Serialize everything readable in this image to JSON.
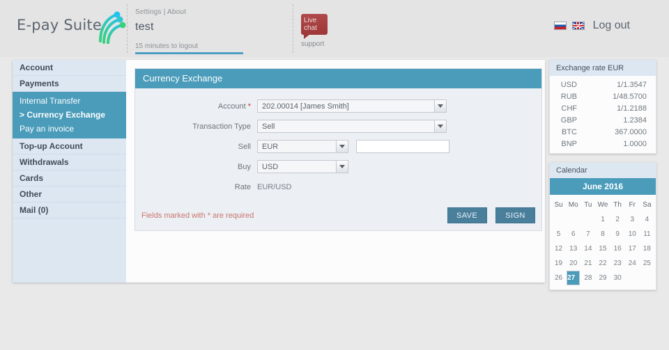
{
  "header": {
    "brand": "E-pay Suite",
    "logo_icon": "epay-swoosh-logo",
    "settings_label": "Settings",
    "settings_separator": "|",
    "about_label": "About",
    "account_name": "test",
    "logout_timer": "15 minutes to logout",
    "livechat_line1": "Live",
    "livechat_line2": "chat",
    "livechat_support": "support",
    "flag_ru": "flag-russia-icon",
    "flag_gb": "flag-uk-icon",
    "logout_label": "Log out"
  },
  "sidebar": {
    "items": [
      {
        "label": "Account"
      },
      {
        "label": "Payments"
      },
      {
        "label": "Top-up Account"
      },
      {
        "label": "Withdrawals"
      },
      {
        "label": "Cards"
      },
      {
        "label": "Other"
      },
      {
        "label": "Mail (0)"
      }
    ],
    "subitems": [
      {
        "label": "Internal Transfer"
      },
      {
        "label": "> Currency Exchange"
      },
      {
        "label": "Pay an invoice"
      }
    ]
  },
  "form": {
    "title": "Currency Exchange",
    "account_label": "Account",
    "account_required_mark": "*",
    "account_value": "202.00014 [James Smith]",
    "txtype_label": "Transaction Type",
    "txtype_value": "Sell",
    "sell_label": "Sell",
    "sell_currency": "EUR",
    "sell_amount": "",
    "sell_amount_placeholder": "",
    "buy_label": "Buy",
    "buy_currency": "USD",
    "rate_label": "Rate",
    "rate_value": "EUR/USD",
    "required_note": "Fields marked with * are required",
    "save_label": "SAVE",
    "sign_label": "SIGN"
  },
  "rates": {
    "title": "Exchange rate EUR",
    "rows": [
      {
        "currency": "USD",
        "value": "1/1.3547"
      },
      {
        "currency": "RUB",
        "value": "1/48.5700"
      },
      {
        "currency": "CHF",
        "value": "1/1.2188"
      },
      {
        "currency": "GBP",
        "value": "1.2384"
      },
      {
        "currency": "BTC",
        "value": "367.0000"
      },
      {
        "currency": "BNP",
        "value": "1.0000"
      }
    ]
  },
  "calendar": {
    "title": "Calendar",
    "month": "June 2016",
    "dow": [
      "Su",
      "Mo",
      "Tu",
      "We",
      "Th",
      "Fr",
      "Sa"
    ],
    "weeks": [
      [
        "",
        "",
        "",
        "1",
        "2",
        "3",
        "4"
      ],
      [
        "5",
        "6",
        "7",
        "8",
        "9",
        "10",
        "11"
      ],
      [
        "12",
        "13",
        "14",
        "15",
        "16",
        "17",
        "18"
      ],
      [
        "19",
        "20",
        "21",
        "22",
        "23",
        "24",
        "25"
      ],
      [
        "26",
        "27",
        "28",
        "29",
        "30",
        "",
        ""
      ]
    ],
    "selected_day": "27"
  },
  "colors": {
    "accent_teal": "#4a9cba",
    "button_blue": "#4a7f9c",
    "sidebar_blue": "#dce7f2",
    "page_bg": "#e9e9e9",
    "required_red": "#c9766e",
    "livechat_red": "#a83f3f"
  }
}
